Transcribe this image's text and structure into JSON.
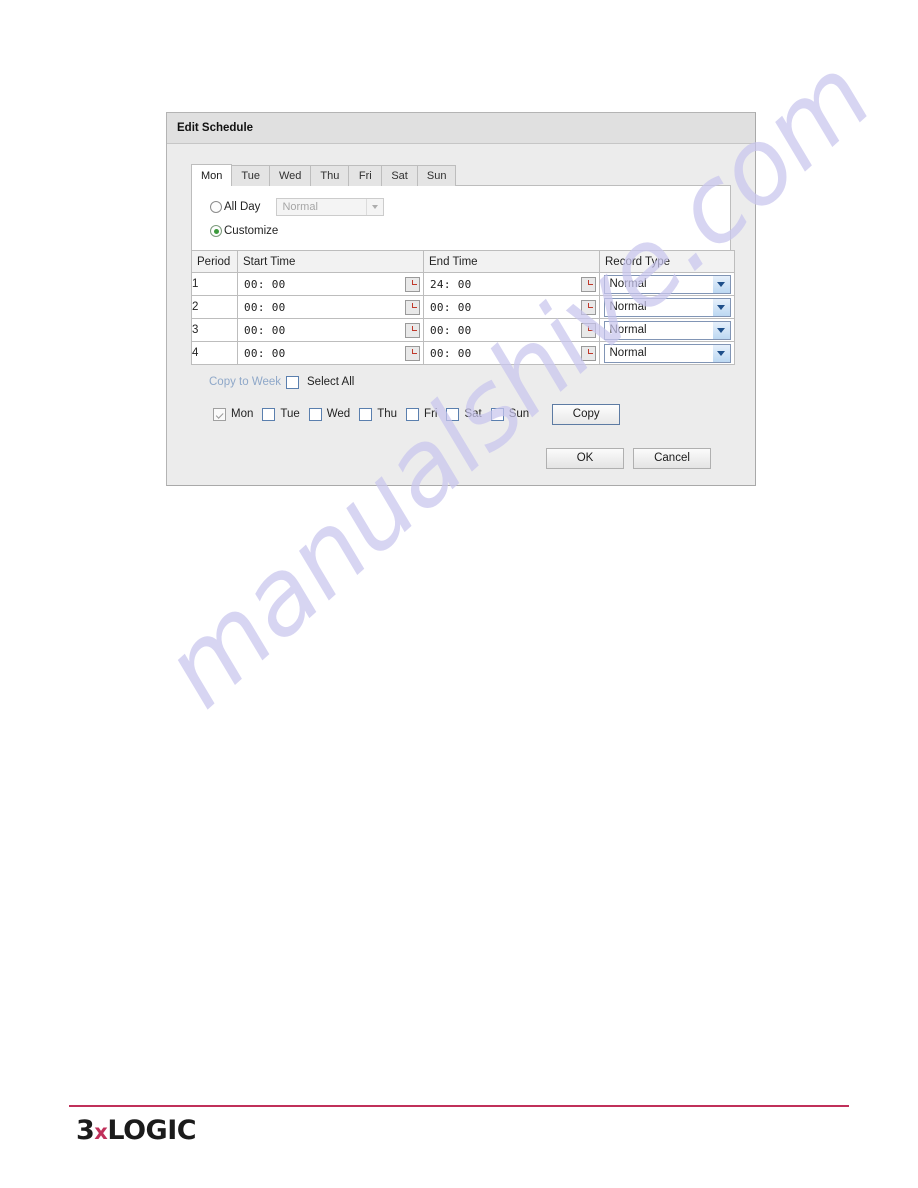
{
  "dialog": {
    "title": "Edit Schedule",
    "tabs": [
      {
        "label": "Mon",
        "active": true
      },
      {
        "label": "Tue",
        "active": false
      },
      {
        "label": "Wed",
        "active": false
      },
      {
        "label": "Thu",
        "active": false
      },
      {
        "label": "Fri",
        "active": false
      },
      {
        "label": "Sat",
        "active": false
      },
      {
        "label": "Sun",
        "active": false
      }
    ],
    "mode": {
      "all_day_label": "All Day",
      "all_day_selected": false,
      "customize_label": "Customize",
      "customize_selected": true,
      "all_day_record_type": "Normal"
    },
    "table": {
      "headers": [
        "Period",
        "Start Time",
        "End Time",
        "Record Type"
      ],
      "rows": [
        {
          "period": "1",
          "start": "00: 00",
          "end": "24: 00",
          "type": "Normal"
        },
        {
          "period": "2",
          "start": "00: 00",
          "end": "00: 00",
          "type": "Normal"
        },
        {
          "period": "3",
          "start": "00: 00",
          "end": "00: 00",
          "type": "Normal"
        },
        {
          "period": "4",
          "start": "00: 00",
          "end": "00: 00",
          "type": "Normal"
        }
      ]
    },
    "copy_to_week": {
      "label": "Copy to Week",
      "select_all_label": "Select All",
      "select_all_checked": false,
      "days": [
        {
          "label": "Mon",
          "checked": true,
          "disabled": true
        },
        {
          "label": "Tue",
          "checked": false,
          "disabled": false
        },
        {
          "label": "Wed",
          "checked": false,
          "disabled": false
        },
        {
          "label": "Thu",
          "checked": false,
          "disabled": false
        },
        {
          "label": "Fri",
          "checked": false,
          "disabled": false
        },
        {
          "label": "Sat",
          "checked": false,
          "disabled": false
        },
        {
          "label": "Sun",
          "checked": false,
          "disabled": false
        }
      ],
      "copy_label": "Copy"
    },
    "footer": {
      "ok_label": "OK",
      "cancel_label": "Cancel"
    }
  },
  "watermark": {
    "text": "manualshive.com"
  },
  "brand": {
    "prefix": "3",
    "x": "x",
    "suffix": "LOGIC",
    "rule_color": "#c0305a"
  }
}
